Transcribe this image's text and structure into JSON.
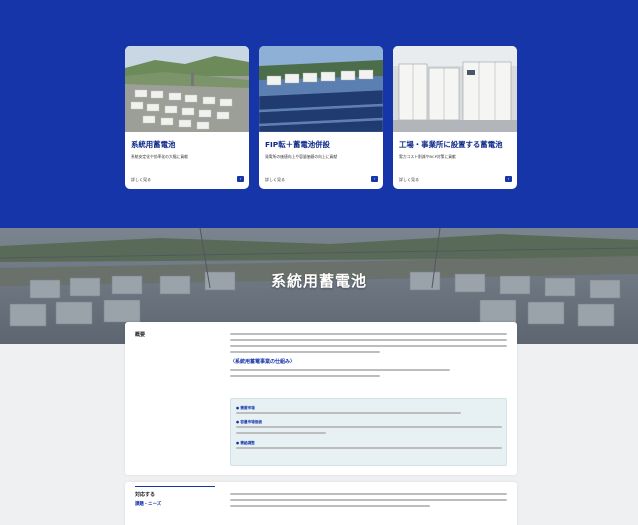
{
  "cards": [
    {
      "title": "系統用蓄電池",
      "desc": "系統安定化や効率化の大幅に貢献",
      "more": "詳しく見る"
    },
    {
      "title": "FIP転＋蓄電池併設",
      "desc": "発電所の価値向上や容量価値の向上に貢献",
      "more": "詳しく見る"
    },
    {
      "title": "工場・事業所に設置する蓄電池",
      "desc": "電力コスト削減やBCP対策に貢献",
      "more": "詳しく見る"
    }
  ],
  "hero": {
    "title": "系統用蓄電池"
  },
  "overview": {
    "label": "概要",
    "subheading": "〈系統用蓄電事業の仕組み〉",
    "bullets": [
      "● 需要市場",
      "● 容量市場価値",
      "● 需給調整"
    ]
  },
  "needs": {
    "label_line1": "対応する",
    "label_line2": "課題・ニーズ"
  },
  "colors": {
    "brand_blue": "#1535a9"
  }
}
